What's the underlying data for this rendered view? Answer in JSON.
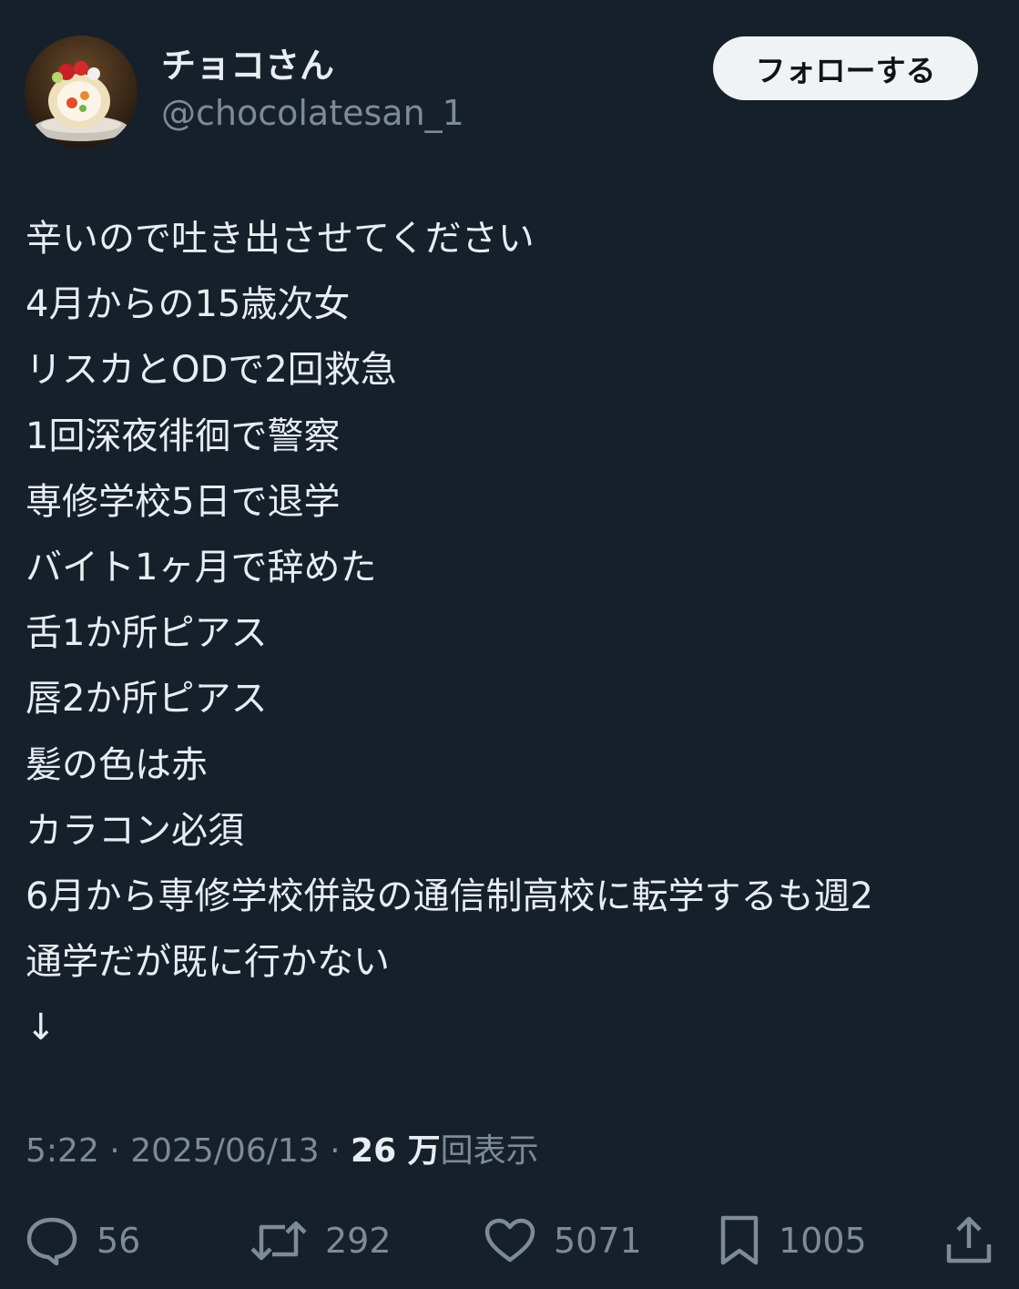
{
  "author": {
    "display_name": "チョコさん",
    "handle": "@chocolatesan_1",
    "avatar_icon": "roll-cake-avatar"
  },
  "follow_label": "フォローする",
  "body_lines": [
    "辛いので吐き出させてください",
    "4月からの15歳次女",
    "リスカとODで2回救急",
    "1回深夜徘徊で警察",
    "専修学校5日で退学",
    "バイト1ヶ月で辞めた",
    "舌1か所ピアス",
    "唇2か所ピアス",
    "髪の色は赤",
    "カラコン必須",
    "6月から専修学校併設の通信制高校に転学するも週2",
    "通学だが既に行かない",
    "↓"
  ],
  "meta": {
    "time": "5:22",
    "date": "2025/06/13",
    "separator": " · ",
    "views_count": "26 万",
    "views_label": "回表示"
  },
  "actions": {
    "replies": "56",
    "retweets": "292",
    "likes": "5071",
    "bookmarks": "1005"
  },
  "colors": {
    "background": "#16202b",
    "text": "#e8edf2",
    "secondary": "#7d8a97",
    "button_bg": "#eff3f4"
  }
}
